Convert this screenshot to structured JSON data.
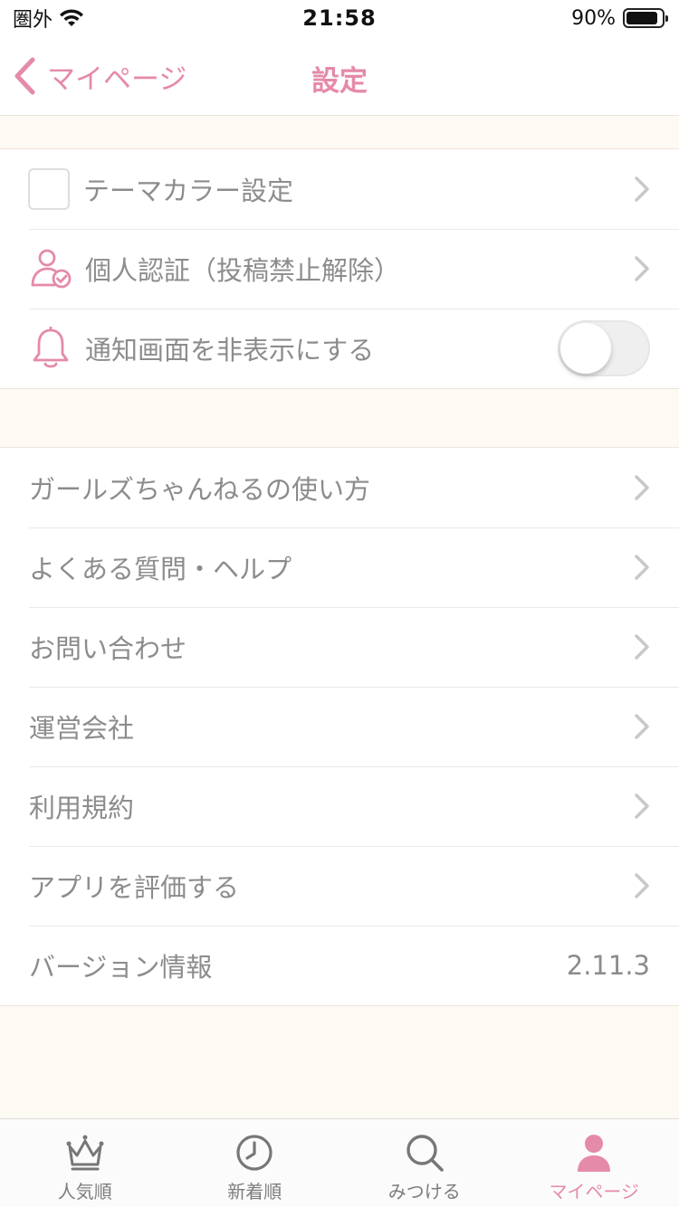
{
  "status_bar": {
    "carrier": "圏外",
    "time": "21:58",
    "battery_text": "90%",
    "battery_level": 0.9
  },
  "nav": {
    "back_label": "マイページ",
    "title": "設定"
  },
  "section1": {
    "items": [
      {
        "label": "テーマカラー設定",
        "icon": "theme-color-swatch"
      },
      {
        "label": "個人認証（投稿禁止解除）",
        "icon": "user-check-icon"
      },
      {
        "label": "通知画面を非表示にする",
        "icon": "bell-icon",
        "toggle": false
      }
    ]
  },
  "section2": {
    "items": [
      {
        "label": "ガールズちゃんねるの使い方"
      },
      {
        "label": "よくある質問・ヘルプ"
      },
      {
        "label": "お問い合わせ"
      },
      {
        "label": "運営会社"
      },
      {
        "label": "利用規約"
      },
      {
        "label": "アプリを評価する"
      },
      {
        "label": "バージョン情報",
        "value": "2.11.3"
      }
    ]
  },
  "tabs": [
    {
      "label": "人気順",
      "icon": "crown-icon",
      "active": false
    },
    {
      "label": "新着順",
      "icon": "clock-icon",
      "active": false
    },
    {
      "label": "みつける",
      "icon": "search-icon",
      "active": false
    },
    {
      "label": "マイページ",
      "icon": "user-icon",
      "active": true
    }
  ],
  "colors": {
    "accent": "#e58aa9",
    "background": "#fdf9f3",
    "text": "#8c8c8c"
  }
}
